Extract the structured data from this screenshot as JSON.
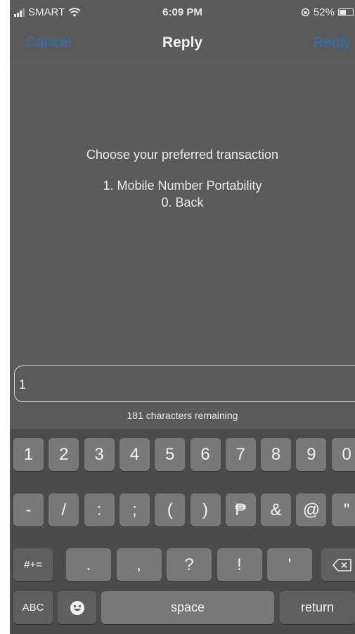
{
  "status_bar": {
    "carrier": "SMART",
    "time": "6:09 PM",
    "battery": "52%",
    "battery_level": 0.52
  },
  "nav": {
    "cancel_label": "Cancel",
    "title": "Reply",
    "reply_label": "Reply"
  },
  "message": {
    "line1": "Choose your preferred transaction",
    "line2": "1. Mobile Number Portability",
    "line3": "0. Back"
  },
  "input": {
    "value": "1"
  },
  "remaining_text": "181 characters remaining",
  "keyboard": {
    "row1": [
      "1",
      "2",
      "3",
      "4",
      "5",
      "6",
      "7",
      "8",
      "9",
      "0"
    ],
    "row2": [
      "-",
      "/",
      ":",
      ";",
      "(",
      ")",
      "₱",
      "&",
      "@",
      "\""
    ],
    "row3_mode": "#+=",
    "row3": [
      ".",
      ",",
      "?",
      "!",
      "'"
    ],
    "abc_label": "ABC",
    "space_label": "space",
    "return_label": "return"
  },
  "colors": {
    "accent": "#2f6fb5",
    "background": "#5a5a5a",
    "keyboard_bg": "#4b4b4b"
  }
}
